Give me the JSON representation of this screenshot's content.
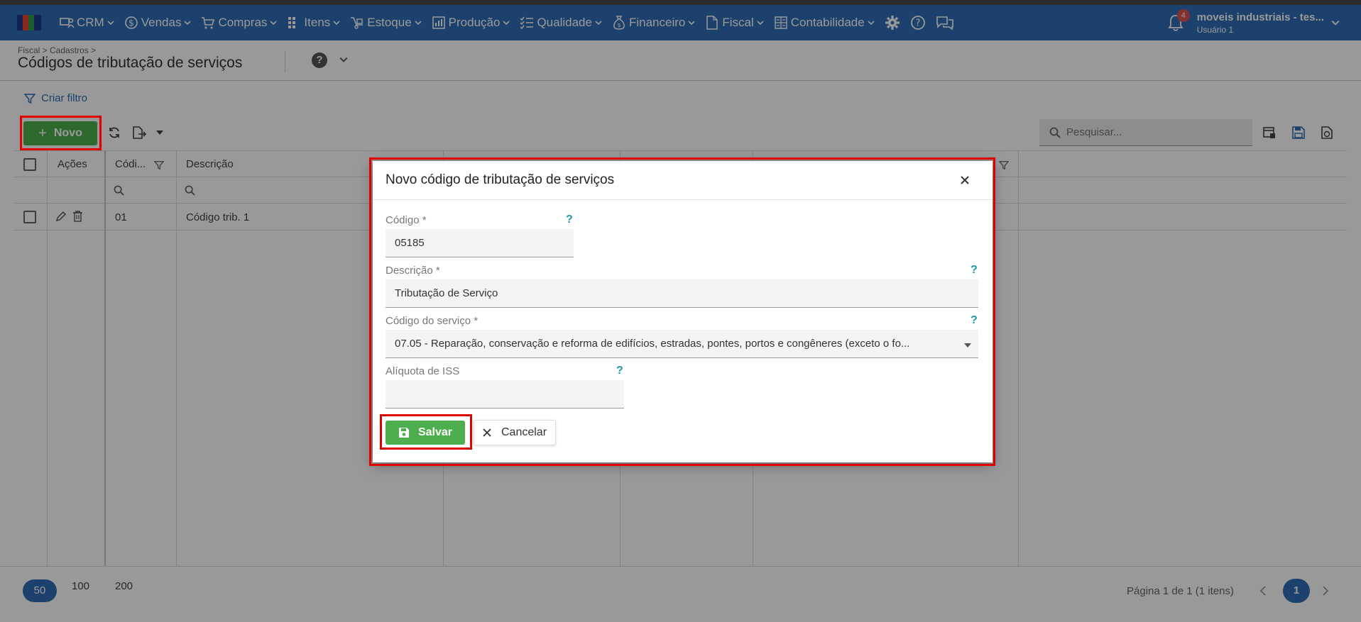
{
  "navbar": {
    "items": [
      {
        "label": "CRM",
        "icon": "crm-icon"
      },
      {
        "label": "Vendas",
        "icon": "dollar-icon"
      },
      {
        "label": "Compras",
        "icon": "cart-icon"
      },
      {
        "label": "Itens",
        "icon": "items-icon"
      },
      {
        "label": "Estoque",
        "icon": "stock-icon"
      },
      {
        "label": "Produção",
        "icon": "chart-icon"
      },
      {
        "label": "Qualidade",
        "icon": "checklist-icon"
      },
      {
        "label": "Financeiro",
        "icon": "money-bag-icon"
      },
      {
        "label": "Fiscal",
        "icon": "document-icon"
      },
      {
        "label": "Contabilidade",
        "icon": "ledger-icon"
      }
    ],
    "notification_count": "4",
    "user_name": "moveis industriais - tes...",
    "user_sub": "Usuário 1",
    "color": "#2f6db5"
  },
  "header": {
    "breadcrumb": "Fiscal > Cadastros >",
    "title": "Códigos de tributação de serviços"
  },
  "toolbar": {
    "filter_label": "Criar filtro",
    "new_label": "Novo",
    "search_placeholder": "Pesquisar..."
  },
  "grid": {
    "columns": [
      "Ações",
      "Códi...",
      "Descrição"
    ],
    "rows": [
      {
        "codigo": "01",
        "descricao": "Código trib. 1"
      }
    ]
  },
  "pagination": {
    "sizes": [
      "50",
      "100",
      "200"
    ],
    "info": "Página 1 de 1 (1 itens)",
    "current_page": "1"
  },
  "dialog": {
    "title": "Novo código de tributação de serviços",
    "fields": {
      "codigo": {
        "label": "Código *",
        "value": "05185"
      },
      "descricao": {
        "label": "Descrição *",
        "value": "Tributação de Serviço"
      },
      "codigo_servico": {
        "label": "Código do serviço *",
        "value": "07.05 -  Reparação, conservação e reforma de edifícios, estradas, pontes, portos e congêneres (exceto o fo..."
      },
      "aliquota": {
        "label": "Alíquota de ISS",
        "value": ""
      }
    },
    "help_mark": "?",
    "save_label": "Salvar",
    "cancel_label": "Cancelar"
  },
  "colors": {
    "primary": "#2f6db5",
    "success": "#4cae4c",
    "highlight": "#e00000",
    "help": "#1a9aa8"
  }
}
